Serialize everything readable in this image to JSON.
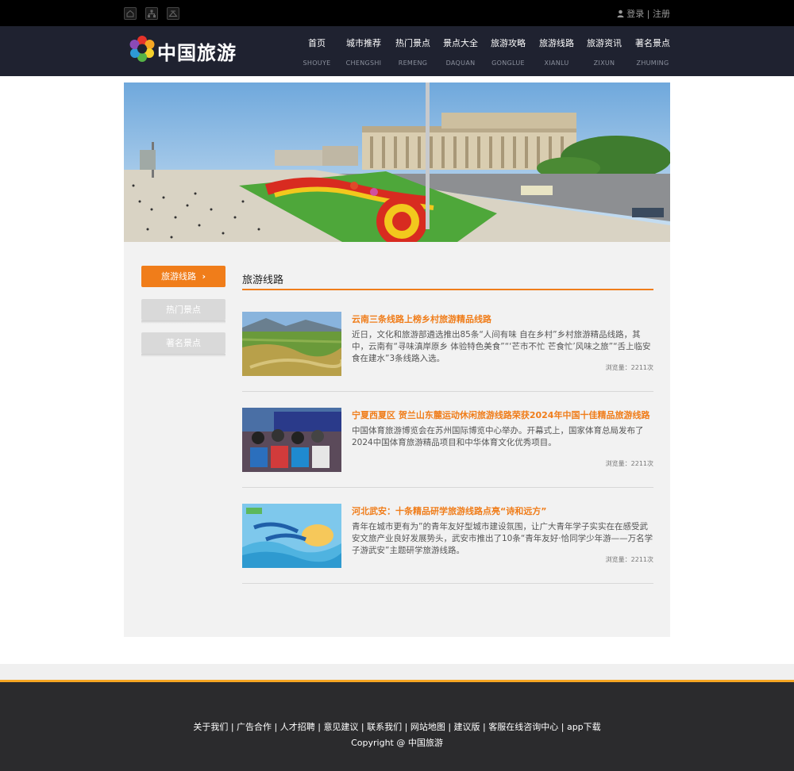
{
  "topbar": {
    "icons": [
      "home-icon",
      "sitemap-icon",
      "bookmark-icon"
    ],
    "login_label": "登录",
    "separator": "|",
    "register_label": "注册"
  },
  "header": {
    "logo_text": "中国旅游",
    "nav": [
      {
        "cn": "首页",
        "en": "SHOUYE"
      },
      {
        "cn": "城市推荐",
        "en": "CHENGSHI"
      },
      {
        "cn": "热门景点",
        "en": "REMENG"
      },
      {
        "cn": "景点大全",
        "en": "DAQUAN"
      },
      {
        "cn": "旅游攻略",
        "en": "GONGLUE"
      },
      {
        "cn": "旅游线路",
        "en": "XIANLU"
      },
      {
        "cn": "旅游资讯",
        "en": "ZIXUN"
      },
      {
        "cn": "著名景点",
        "en": "ZHUMING"
      }
    ]
  },
  "sidebar": {
    "items": [
      {
        "label": "旅游线路",
        "active": true
      },
      {
        "label": "热门景点",
        "active": false
      },
      {
        "label": "著名景点",
        "active": false
      }
    ],
    "arrow": "›"
  },
  "main": {
    "section_title": "旅游线路",
    "articles": [
      {
        "title": "云南三条线路上榜乡村旅游精品线路",
        "desc": "近日，文化和旅游部遴选推出85条“人间有味 自在乡村”乡村旅游精品线路，其中，云南有“寻味滇岸原乡 体验特色美食”“‘芒市不忙 芒食忙’风味之旅”“舌上临安 食在建水”3条线路入选。",
        "views": "浏览量：2211次"
      },
      {
        "title": "宁夏西夏区 贺兰山东麓运动休闲旅游线路荣获2024年中国十佳精品旅游线路",
        "desc": "中国体育旅游博览会在苏州国际博览中心举办。开幕式上，国家体育总局发布了2024中国体育旅游精品项目和中华体育文化优秀项目。",
        "views": "浏览量：2211次"
      },
      {
        "title": "河北武安：十条精品研学旅游线路点亮“诗和远方”",
        "desc": "青年在城市更有为”的青年友好型城市建设氛围，让广大青年学子实实在在感受武安文旅产业良好发展势头，武安市推出了10条“青年友好·恰同学少年游——万名学子游武安”主题研学旅游线路。",
        "views": "浏览量：2211次"
      }
    ]
  },
  "footer": {
    "links": [
      "关于我们",
      "广告合作",
      "人才招聘",
      "意见建议",
      "联系我们",
      "网站地图",
      "建议版",
      "客服在线咨询中心",
      "app下载"
    ],
    "copyright": "Copyright @ 中国旅游"
  },
  "colors": {
    "accent": "#f07d1a",
    "header_bg": "#1f2230",
    "footer_bg": "#2b2b2d",
    "footer_border": "#f5a623"
  }
}
